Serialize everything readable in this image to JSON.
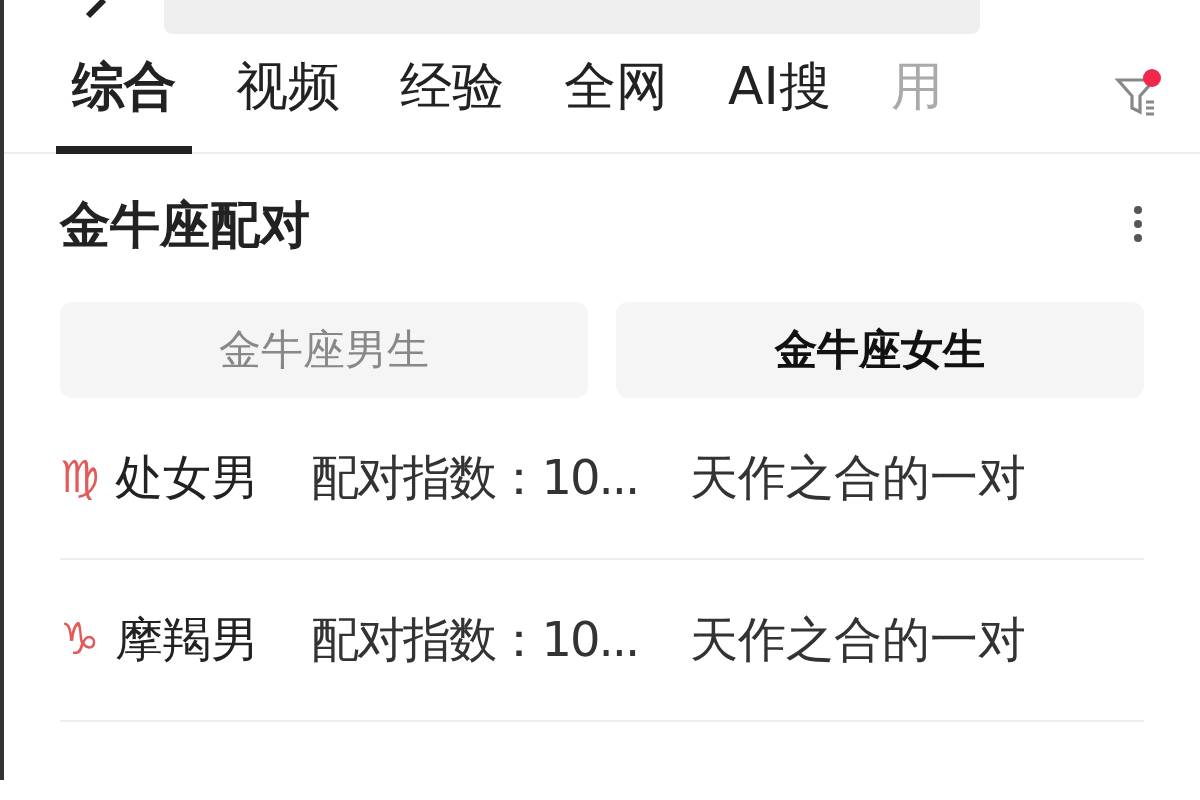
{
  "tabs": [
    {
      "label": "综合",
      "selected": true
    },
    {
      "label": "视频",
      "selected": false
    },
    {
      "label": "经验",
      "selected": false
    },
    {
      "label": "全网",
      "selected": false
    },
    {
      "label": "AI搜",
      "selected": false
    },
    {
      "label": "用",
      "selected": false,
      "faded": true
    }
  ],
  "filter": {
    "badge": true
  },
  "card": {
    "title": "金牛座配对",
    "segments": [
      {
        "label": "金牛座男生",
        "selected": false
      },
      {
        "label": "金牛座女生",
        "selected": true
      }
    ],
    "rows": [
      {
        "symbol": "♍",
        "sign": "处女男",
        "score": "配对指数：10...",
        "verdict": "天作之合的一对"
      },
      {
        "symbol": "♑",
        "sign": "摩羯男",
        "score": "配对指数：10...",
        "verdict": "天作之合的一对"
      }
    ]
  }
}
